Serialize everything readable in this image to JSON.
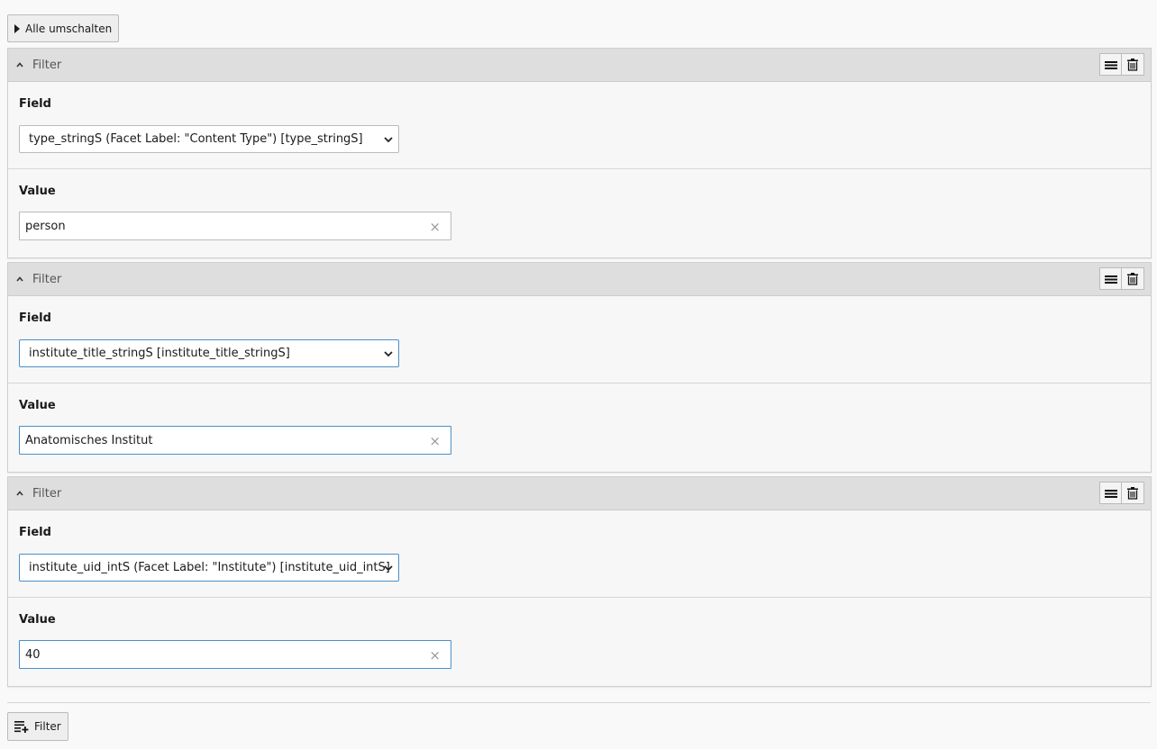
{
  "toolbar": {
    "toggle_all_label": "Alle umschalten"
  },
  "filters": [
    {
      "title": "Filter",
      "field_label": "Field",
      "field_value": "type_stringS (Facet Label: \"Content Type\") [type_stringS]",
      "value_label": "Value",
      "value": "person"
    },
    {
      "title": "Filter",
      "field_label": "Field",
      "field_value": "institute_title_stringS [institute_title_stringS]",
      "value_label": "Value",
      "value": "Anatomisches Institut"
    },
    {
      "title": "Filter",
      "field_label": "Field",
      "field_value": "institute_uid_intS (Facet Label: \"Institute\") [institute_uid_intS]",
      "value_label": "Value",
      "value": "40"
    }
  ],
  "footer": {
    "add_filter_label": "Filter"
  },
  "icons": {
    "toggle": "triangle-right-icon",
    "collapse": "chevron-up-icon",
    "drag": "menu-lines-icon",
    "delete": "trash-icon",
    "clear": "clear-x-icon",
    "add": "add-filter-icon"
  },
  "colors": {
    "header_bg": "#dedede",
    "focus_border": "#4a90c9",
    "panel_bg": "#f7f7f7"
  }
}
